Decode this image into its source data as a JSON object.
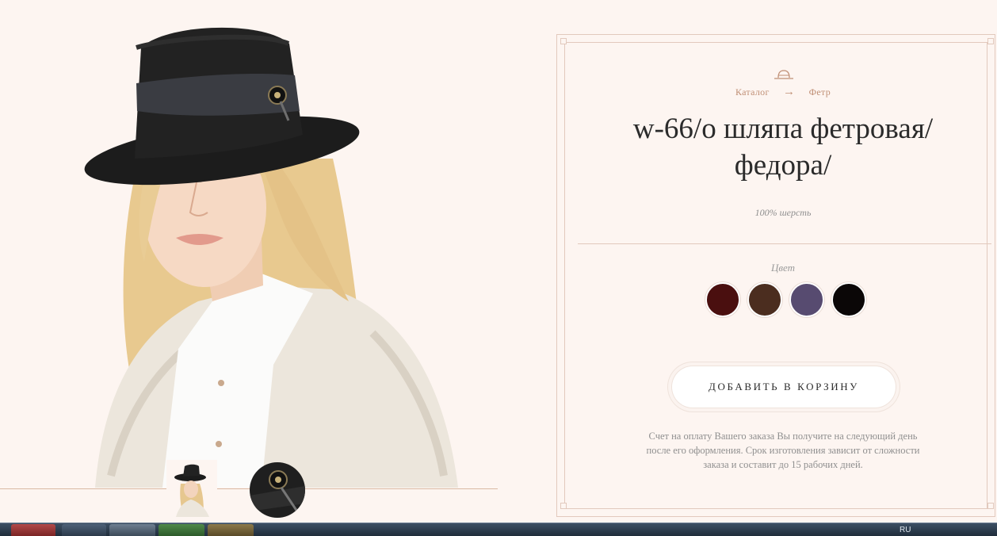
{
  "breadcrumb": {
    "catalog": "Каталог",
    "arrow": "→",
    "category": "Фетр"
  },
  "product": {
    "title": "w-66/о шляпа фетровая/ федора/",
    "material": "100% шерсть"
  },
  "colors": {
    "label": "Цвет",
    "swatches": [
      "#4a0f0f",
      "#4b2d1f",
      "#574b70",
      "#0b0707"
    ]
  },
  "cart": {
    "button_label": "ДОБАВИТЬ В КОРЗИНУ"
  },
  "order_note": "Счет на оплату Вашего заказа Вы получите на следующий день после его оформления. Срок изготовления зависит от сложности заказа и составит до 15 рабочих дней.",
  "taskbar": {
    "language": "RU"
  },
  "icons": {
    "breadcrumb_icon": "hat-icon"
  }
}
